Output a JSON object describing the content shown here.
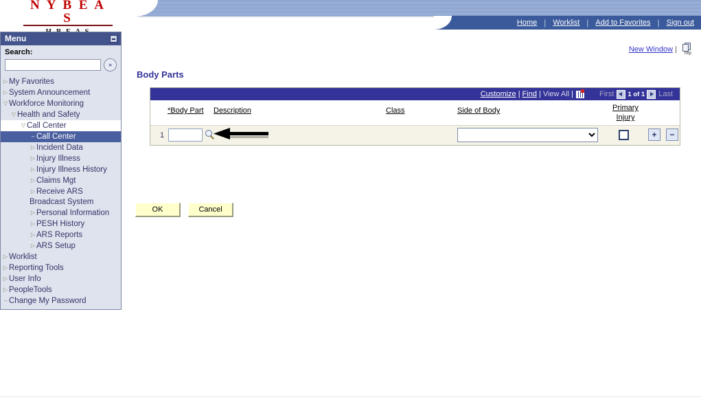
{
  "header": {
    "logo_main": "N Y B E A S",
    "logo_sub": "H B E A S",
    "nav_links": [
      {
        "label": "Home",
        "name": "nav-home"
      },
      {
        "label": "Worklist",
        "name": "nav-worklist"
      },
      {
        "label": "Add to Favorites",
        "name": "nav-add-to-favorites"
      },
      {
        "label": "Sign out",
        "name": "nav-sign-out"
      }
    ],
    "separator": "|"
  },
  "menu": {
    "title": "Menu",
    "search_label": "Search:",
    "search_value": "",
    "search_placeholder": "",
    "go_glyph": "»",
    "minimize_title": "Minimize",
    "tree": [
      {
        "label": "My Favorites",
        "level": 0,
        "twisty": "collapsed"
      },
      {
        "label": "System Announcement",
        "level": 0,
        "twisty": "collapsed"
      },
      {
        "label": "Workforce Monitoring",
        "level": 0,
        "twisty": "expanded"
      },
      {
        "label": "Health and Safety",
        "level": 1,
        "twisty": "expanded"
      },
      {
        "label": "Call Center",
        "level": 2,
        "twisty": "expanded",
        "state": "open"
      },
      {
        "label": "Call Center",
        "level": 3,
        "twisty": "leaf",
        "state": "selected"
      },
      {
        "label": "Incident Data",
        "level": 3,
        "twisty": "collapsed"
      },
      {
        "label": "Injury Illness",
        "level": 3,
        "twisty": "collapsed"
      },
      {
        "label": "Injury Illness History",
        "level": 3,
        "twisty": "collapsed"
      },
      {
        "label": "Claims Mgt",
        "level": 3,
        "twisty": "collapsed"
      },
      {
        "label": "Receive ARS Broadcast System",
        "level": 3,
        "twisty": "collapsed",
        "wrap": true
      },
      {
        "label": "Personal Information",
        "level": 3,
        "twisty": "collapsed"
      },
      {
        "label": "PESH History",
        "level": 3,
        "twisty": "collapsed"
      },
      {
        "label": "ARS Reports",
        "level": 3,
        "twisty": "collapsed"
      },
      {
        "label": "ARS Setup",
        "level": 3,
        "twisty": "collapsed"
      },
      {
        "label": "Worklist",
        "level": 0,
        "twisty": "collapsed"
      },
      {
        "label": "Reporting Tools",
        "level": 0,
        "twisty": "collapsed"
      },
      {
        "label": "User Info",
        "level": 0,
        "twisty": "collapsed"
      },
      {
        "label": "PeopleTools",
        "level": 0,
        "twisty": "collapsed"
      },
      {
        "label": "Change My Password",
        "level": 0,
        "twisty": "leaf",
        "state": "link"
      }
    ],
    "twisty_collapsed": "▷",
    "twisty_expanded": "▽",
    "twisty_leaf": "–"
  },
  "toolbar": {
    "new_window": "New Window",
    "separator": "|",
    "http_icon_caption": "http"
  },
  "main": {
    "page_title": "Body Parts"
  },
  "grid": {
    "customize": "Customize",
    "find": "Find",
    "view_all": "View All",
    "sep": "|",
    "download_icon": "download-grid-icon",
    "first": "First",
    "last": "Last",
    "counter": "1 of 1",
    "columns": [
      {
        "label": "*Body Part",
        "name": "col-body-part"
      },
      {
        "label": "Description",
        "name": "col-description"
      },
      {
        "label": "Class",
        "name": "col-class"
      },
      {
        "label": "Side of Body",
        "name": "col-side-of-body"
      },
      {
        "label_line1": "Primary",
        "label_line2": "Injury",
        "name": "col-primary-injury"
      }
    ],
    "rows": [
      {
        "number": "1",
        "body_part": "",
        "description": "",
        "class": "",
        "side_of_body": "",
        "primary_injury": false,
        "add_label": "+",
        "delete_label": "−"
      }
    ]
  },
  "actions": {
    "ok": "OK",
    "cancel": "Cancel"
  },
  "colors": {
    "brand_red": "#c00000",
    "nav_blue": "#3a5a9b",
    "grid_header_blue": "#333399",
    "menu_header": "#43538c",
    "menu_selected": "#4a5fa0",
    "row_beige": "#f5f3e7",
    "button_yellow": "#ffffcc",
    "link_blue": "#3333cc"
  }
}
